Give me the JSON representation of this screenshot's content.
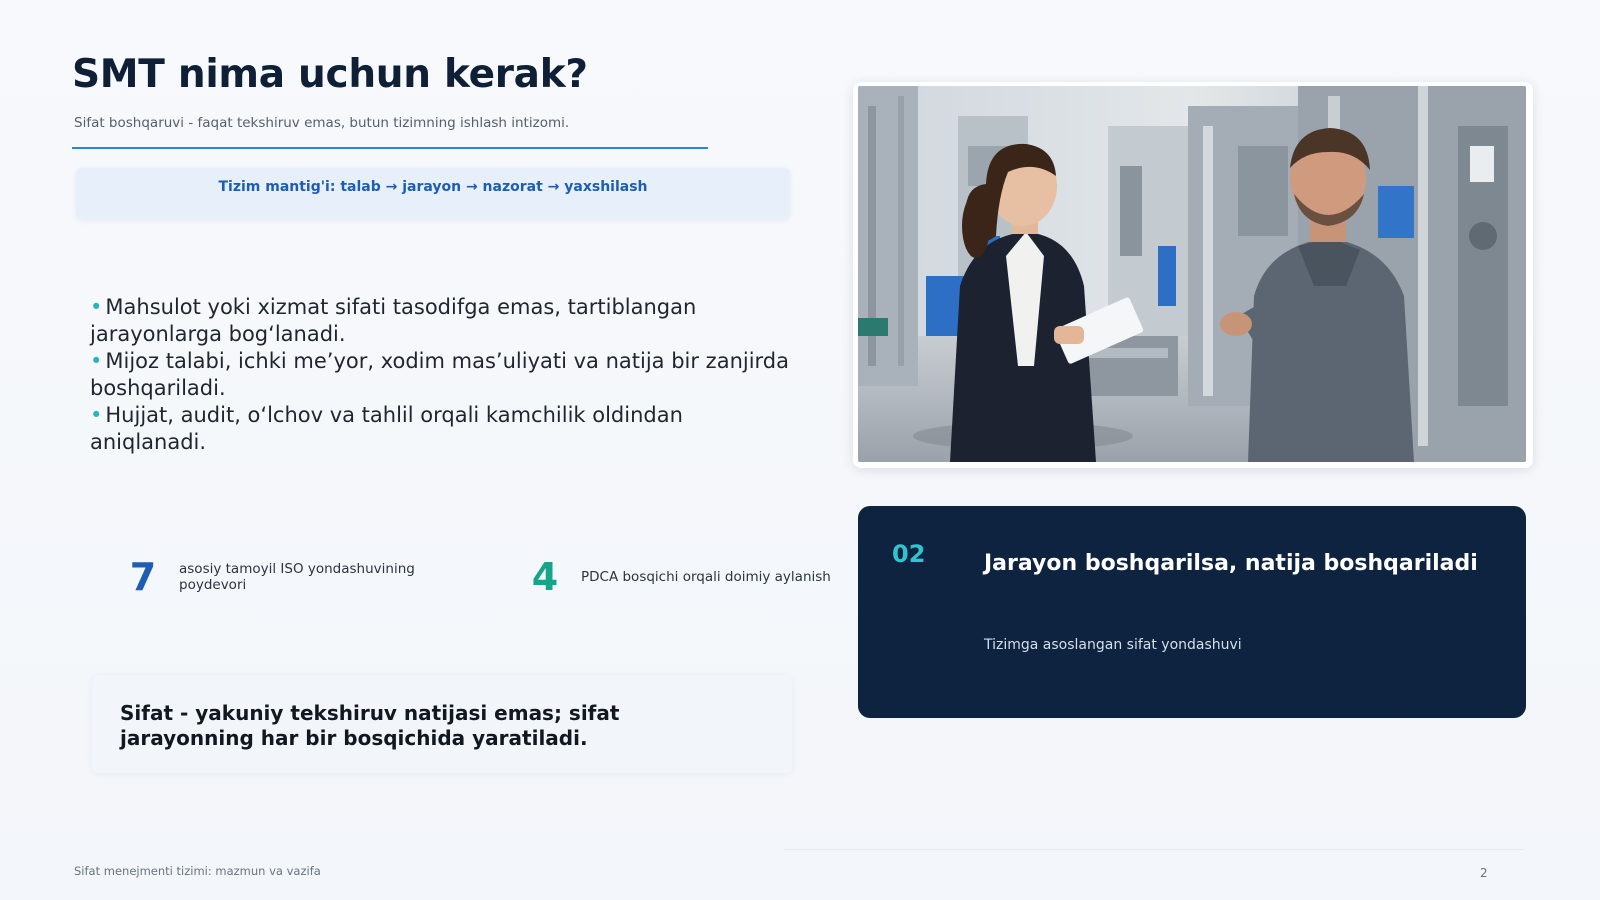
{
  "slide": {
    "title": "SMT nima uchun kerak?",
    "subtitle": "Sifat boshqaruvi - faqat tekshiruv emas, butun tizimning ishlash intizomi.",
    "logic": "Tizim mantig'i: talab → jarayon → nazorat → yaxshilash",
    "bullets": [
      "Mahsulot yoki xizmat sifati tasodifga emas, tartiblangan jarayonlarga bog‘lanadi.",
      "Mijoz talabi, ichki me’yor, xodim mas’uliyati va natija bir zanjirda boshqariladi.",
      "Hujjat, audit, o‘lchov va tahlil orqali kamchilik oldindan aniqlanadi."
    ],
    "bullet_marker": "•",
    "stats": [
      {
        "value": "7",
        "label": "asosiy tamoyil ISO yondashuvining poydevori"
      },
      {
        "value": "4",
        "label": "PDCA bosqichi orqali doimiy aylanish"
      }
    ],
    "quote": "Sifat - yakuniy tekshiruv natijasi emas; sifat jarayonning har bir bosqichida yaratiladi.",
    "card": {
      "number": "02",
      "title": "Jarayon boshqarilsa, natija boshqariladi",
      "subtitle": "Tizimga asoslangan sifat yondashuvi"
    },
    "footer": {
      "left": "Sifat menejmenti tizimi: mazmun va vazifa",
      "page": "2"
    },
    "colors": {
      "accent_blue": "#1e5db3",
      "accent_teal": "#17a58a",
      "card_bg": "#0e2340",
      "card_number": "#2fc4cf"
    }
  }
}
